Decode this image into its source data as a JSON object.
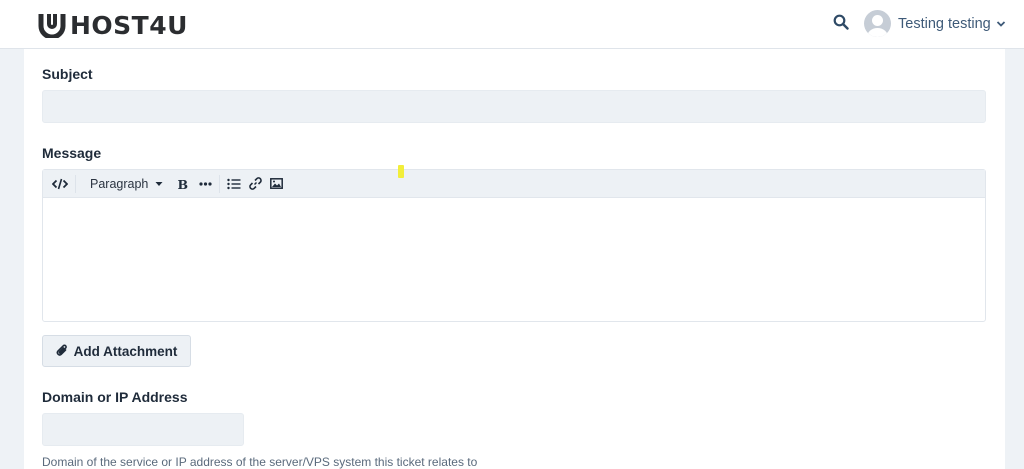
{
  "header": {
    "logo_text": "HOST4U",
    "user_name": "Testing testing"
  },
  "icons": {
    "search": "search-icon",
    "avatar": "user-avatar-icon",
    "chevron": "chevron-down-icon",
    "code": "code-icon",
    "bold": "bold-icon",
    "more": "more-icon",
    "list": "bulleted-list-icon",
    "link": "link-icon",
    "image": "image-icon",
    "paperclip": "paperclip-icon"
  },
  "form": {
    "subject_label": "Subject",
    "subject_value": "",
    "message_label": "Message",
    "editor": {
      "paragraph_label": "Paragraph",
      "content": ""
    },
    "attachment_button": "Add Attachment",
    "domain_label": "Domain or IP Address",
    "domain_value": "",
    "domain_help": "Domain of the service or IP address of the server/VPS system this ticket relates to"
  },
  "colors": {
    "accent": "#3e5a78",
    "input_bg": "#edf1f5",
    "page_bg": "#eef2f6"
  }
}
